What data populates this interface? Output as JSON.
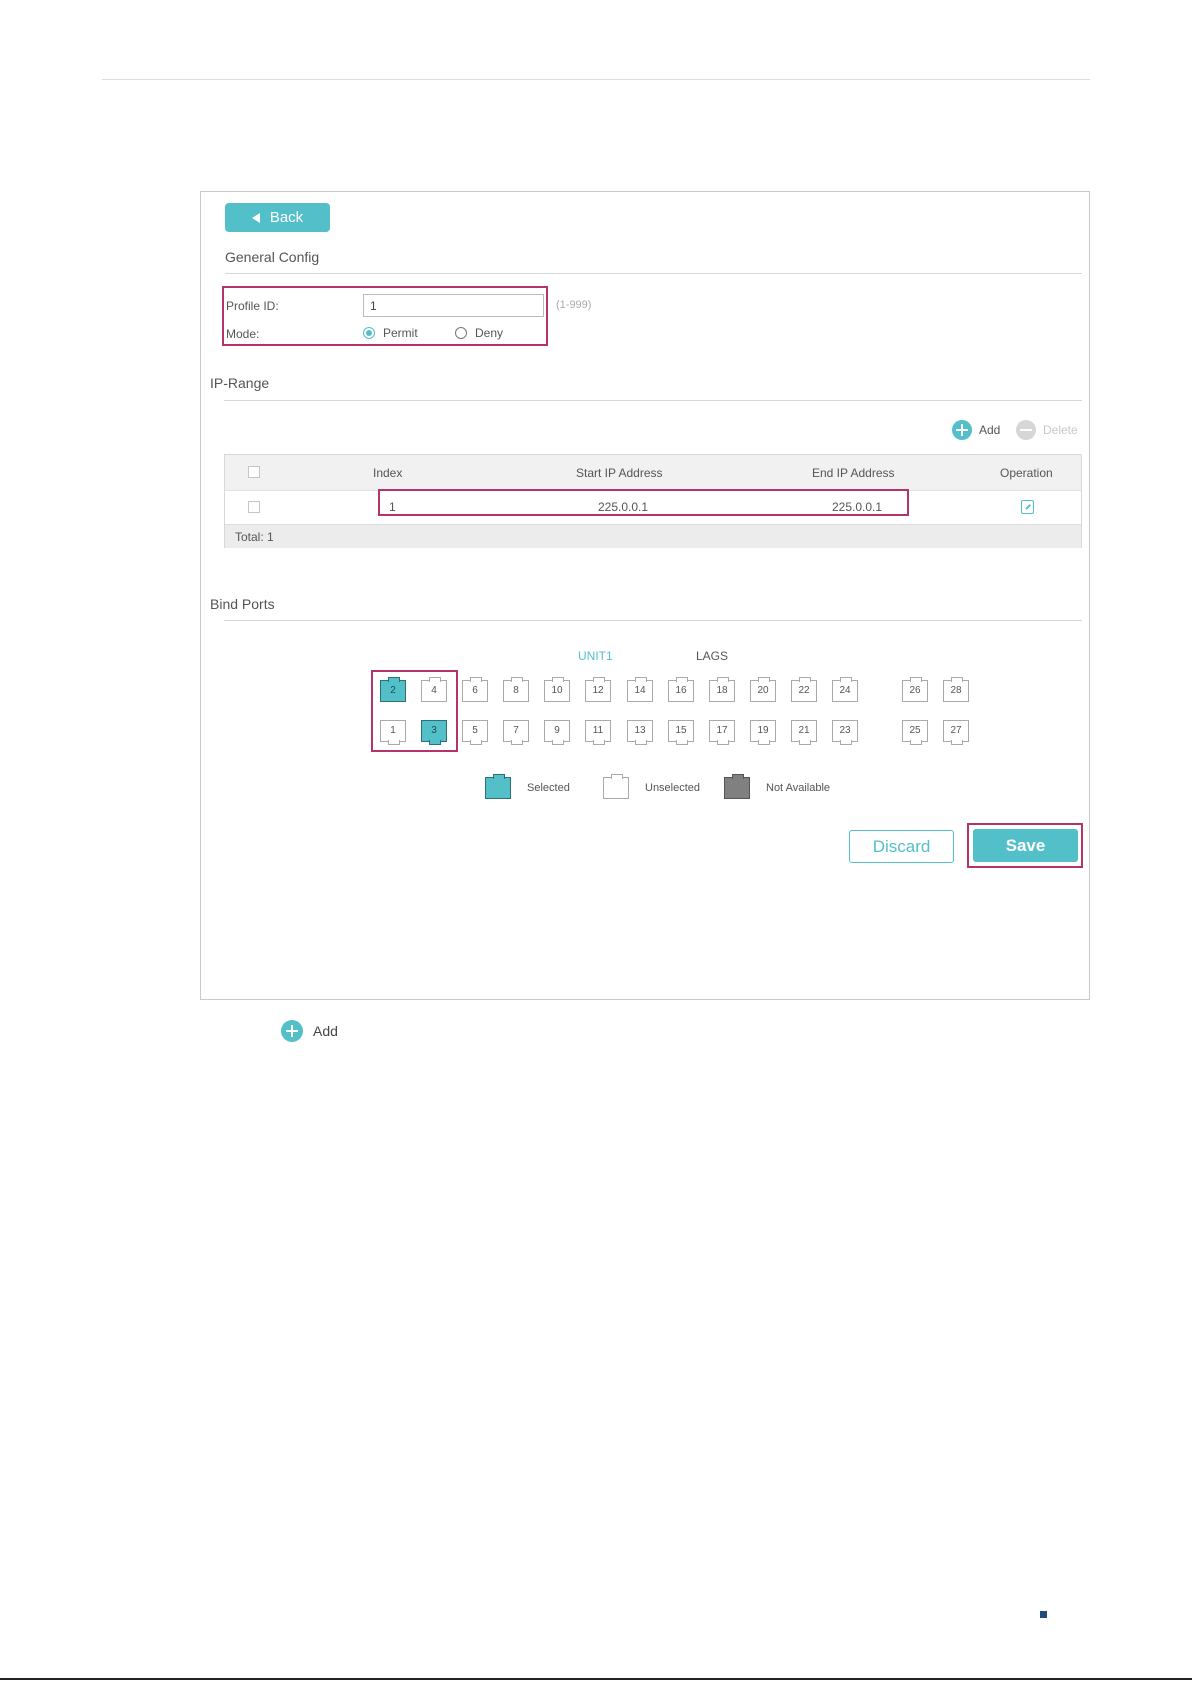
{
  "back_label": "Back",
  "general": {
    "title": "General Config",
    "profile_id_label": "Profile ID:",
    "profile_id_value": "1",
    "profile_id_hint": "(1-999)",
    "mode_label": "Mode:",
    "mode_options": [
      "Permit",
      "Deny"
    ],
    "mode_selected": "Permit"
  },
  "ip_range": {
    "title": "IP-Range",
    "add_label": "Add",
    "delete_label": "Delete",
    "columns": [
      "Index",
      "Start IP Address",
      "End IP Address",
      "Operation"
    ],
    "rows": [
      {
        "index": "1",
        "start_ip": "225.0.0.1",
        "end_ip": "225.0.0.1"
      }
    ],
    "total": "Total: 1"
  },
  "bind_ports": {
    "title": "Bind Ports",
    "unit_tab": "UNIT1",
    "lag_tab": "LAGS",
    "top_ports": [
      "2",
      "4",
      "6",
      "8",
      "10",
      "12",
      "14",
      "16",
      "18",
      "20",
      "22",
      "24",
      "26",
      "28"
    ],
    "bottom_ports": [
      "1",
      "3",
      "5",
      "7",
      "9",
      "11",
      "13",
      "15",
      "17",
      "19",
      "21",
      "23",
      "25",
      "27"
    ],
    "selected_ports": [
      "2",
      "3"
    ],
    "legend": {
      "selected": "Selected",
      "unselected": "Unselected",
      "not_available": "Not Available"
    }
  },
  "actions": {
    "discard": "Discard",
    "save": "Save"
  },
  "footnote": {
    "add_label": "Add"
  },
  "colors": {
    "accent": "#53bfc9",
    "highlight": "#b4336a"
  }
}
